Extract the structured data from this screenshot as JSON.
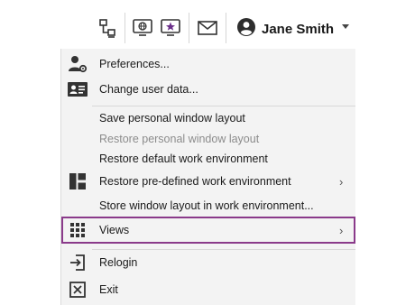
{
  "header": {
    "user_name": "Jane Smith",
    "icons": [
      "network-icon",
      "monitor-globe-icon",
      "monitor-star-icon",
      "mail-icon",
      "user-avatar-icon"
    ]
  },
  "menu": {
    "items": [
      {
        "label": "Preferences...",
        "icon": "user-gear-icon"
      },
      {
        "label": "Change user data...",
        "icon": "id-card-icon"
      },
      {
        "label": "Save personal window layout"
      },
      {
        "label": "Restore personal window layout",
        "disabled": true
      },
      {
        "label": "Restore default work environment"
      },
      {
        "label": "Restore pre-defined work environment",
        "icon": "layout-icon",
        "chevron": "›"
      },
      {
        "label": "Store window layout in work environment..."
      },
      {
        "label": "Views",
        "icon": "grid-icon",
        "chevron": "›",
        "highlighted": true
      },
      {
        "label": "Relogin",
        "icon": "relogin-icon"
      },
      {
        "label": "Exit",
        "icon": "exit-icon"
      }
    ]
  },
  "colors": {
    "highlight_border": "#8a3a8a",
    "menu_background": "#f3f3f3",
    "disabled_text": "#8c8c8c"
  }
}
